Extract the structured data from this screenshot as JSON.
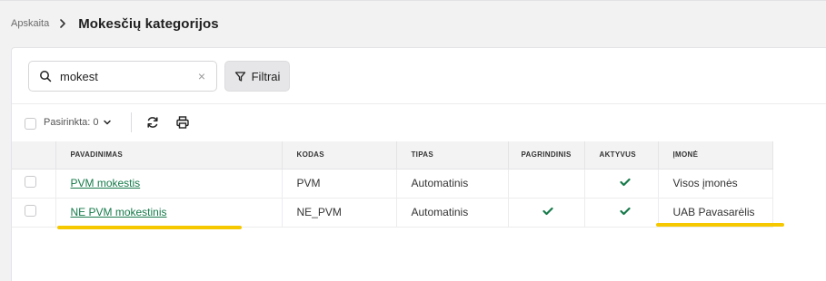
{
  "breadcrumb": {
    "root": "Apskaita",
    "title": "Mokesčių kategorijos"
  },
  "search": {
    "value": "mokest",
    "clear_glyph": "×"
  },
  "filters": {
    "label": "Filtrai"
  },
  "toolbar": {
    "selected_label": "Pasirinkta: 0"
  },
  "table": {
    "headers": [
      "PAVADINIMAS",
      "KODAS",
      "TIPAS",
      "PAGRINDINIS",
      "AKTYVUS",
      "ĮMONĖ"
    ],
    "rows": [
      {
        "name": "PVM mokestis",
        "code": "PVM",
        "type": "Automatinis",
        "primary": false,
        "active": true,
        "company": "Visos įmonės"
      },
      {
        "name": "NE PVM mokestinis",
        "code": "NE_PVM",
        "type": "Automatinis",
        "primary": true,
        "active": true,
        "company": "UAB Pavasarėlis"
      }
    ]
  },
  "colors": {
    "accent_green": "#167a4a",
    "highlight": "#f5c800"
  }
}
